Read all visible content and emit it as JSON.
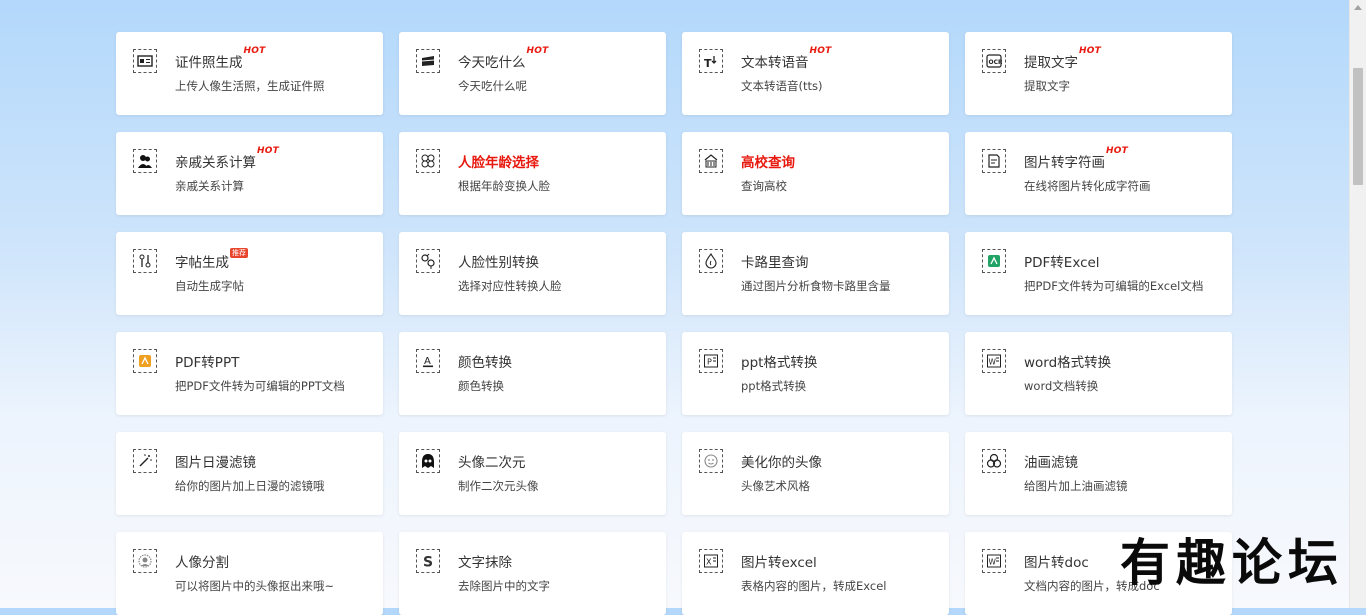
{
  "tools": [
    {
      "title": "证件照生成",
      "desc": "上传人像生活照，生成证件照",
      "badge": "HOT",
      "icon": "id-card-icon"
    },
    {
      "title": "今天吃什么",
      "desc": "今天吃什么呢",
      "badge": "HOT",
      "icon": "food-icon"
    },
    {
      "title": "文本转语音",
      "desc": "文本转语音(tts)",
      "badge": "HOT",
      "icon": "text-to-speech-icon"
    },
    {
      "title": "提取文字",
      "desc": "提取文字",
      "badge": "HOT",
      "icon": "ocr-icon"
    },
    {
      "title": "亲戚关系计算",
      "desc": "亲戚关系计算",
      "badge": "HOT",
      "icon": "relatives-icon"
    },
    {
      "title": "人脸年龄选择",
      "desc": "根据年龄变换人脸",
      "badge": "",
      "icon": "face-age-icon",
      "highlight": true
    },
    {
      "title": "高校查询",
      "desc": "查询高校",
      "badge": "",
      "icon": "university-icon",
      "highlight": true
    },
    {
      "title": "图片转字符画",
      "desc": "在线将图片转化成字符画",
      "badge": "HOT",
      "icon": "char-art-icon"
    },
    {
      "title": "字帖生成",
      "desc": "自动生成字帖",
      "badge": "推荐",
      "icon": "copybook-icon"
    },
    {
      "title": "人脸性别转换",
      "desc": "选择对应性转换人脸",
      "badge": "",
      "icon": "gender-icon"
    },
    {
      "title": "卡路里查询",
      "desc": "通过图片分析食物卡路里含量",
      "badge": "",
      "icon": "calorie-icon"
    },
    {
      "title": "PDF转Excel",
      "desc": "把PDF文件转为可编辑的Excel文档",
      "badge": "",
      "icon": "pdf-excel-icon"
    },
    {
      "title": "PDF转PPT",
      "desc": "把PDF文件转为可编辑的PPT文档",
      "badge": "",
      "icon": "pdf-ppt-icon"
    },
    {
      "title": "颜色转换",
      "desc": "颜色转换",
      "badge": "",
      "icon": "color-icon"
    },
    {
      "title": "ppt格式转换",
      "desc": "ppt格式转换",
      "badge": "",
      "icon": "ppt-icon"
    },
    {
      "title": "word格式转换",
      "desc": "word文档转换",
      "badge": "",
      "icon": "word-icon"
    },
    {
      "title": "图片日漫滤镜",
      "desc": "给你的图片加上日漫的滤镜哦",
      "badge": "",
      "icon": "magic-wand-icon"
    },
    {
      "title": "头像二次元",
      "desc": "制作二次元头像",
      "badge": "",
      "icon": "anime-avatar-icon"
    },
    {
      "title": "美化你的头像",
      "desc": "头像艺术风格",
      "badge": "",
      "icon": "smile-icon"
    },
    {
      "title": "油画滤镜",
      "desc": "给图片加上油画滤镜",
      "badge": "",
      "icon": "oil-paint-icon"
    },
    {
      "title": "人像分割",
      "desc": "可以将图片中的头像抠出来哦~",
      "badge": "",
      "icon": "portrait-cut-icon"
    },
    {
      "title": "文字抹除",
      "desc": "去除图片中的文字",
      "badge": "",
      "icon": "text-erase-icon"
    },
    {
      "title": "图片转excel",
      "desc": "表格内容的图片，转成Excel",
      "badge": "",
      "icon": "image-excel-icon"
    },
    {
      "title": "图片转doc",
      "desc": "文档内容的图片，转成doc",
      "badge": "",
      "icon": "image-doc-icon"
    }
  ],
  "watermark": "有趣论坛",
  "colors": {
    "hot": "#e8190e",
    "highlight": "#e8190e",
    "excel": "#21a366",
    "pdf": "#f0a020"
  }
}
